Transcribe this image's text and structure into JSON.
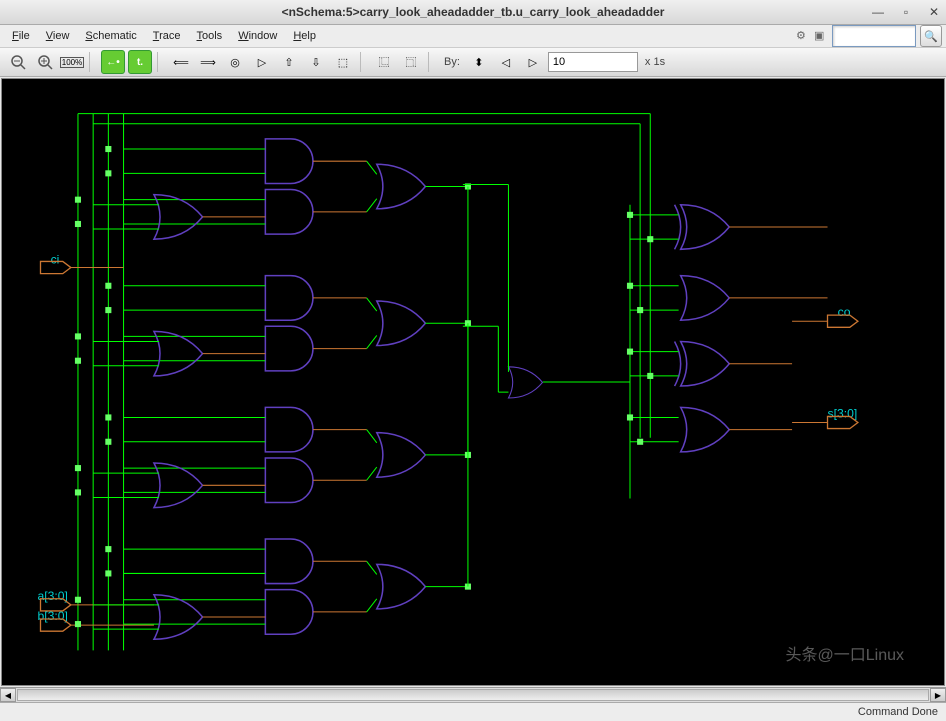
{
  "window": {
    "title": "<nSchema:5>carry_look_aheadadder_tb.u_carry_look_aheadadder"
  },
  "menu": {
    "file": "File",
    "view": "View",
    "schematic": "Schematic",
    "trace": "Trace",
    "tools": "Tools",
    "window": "Window",
    "help": "Help"
  },
  "toolbar": {
    "zoom_pct": "100%",
    "by_label": "By:",
    "time_value": "10",
    "time_unit": "x 1s"
  },
  "ports": {
    "ci": "ci",
    "a": "a[3:0]",
    "b": "b[3:0]",
    "co": "co",
    "s": "s[3:0]"
  },
  "status": {
    "text": "Command Done"
  },
  "watermark": "头条@一口Linux",
  "schematic": {
    "type": "carry_look_ahead_adder",
    "inputs": [
      "ci",
      "a[3:0]",
      "b[3:0]"
    ],
    "outputs": [
      "co",
      "s[3:0]"
    ],
    "gates_per_row": [
      "AND",
      "AND",
      "OR",
      "OR→OR"
    ],
    "rows": 4,
    "output_stage": [
      "XOR/OR×4"
    ]
  }
}
